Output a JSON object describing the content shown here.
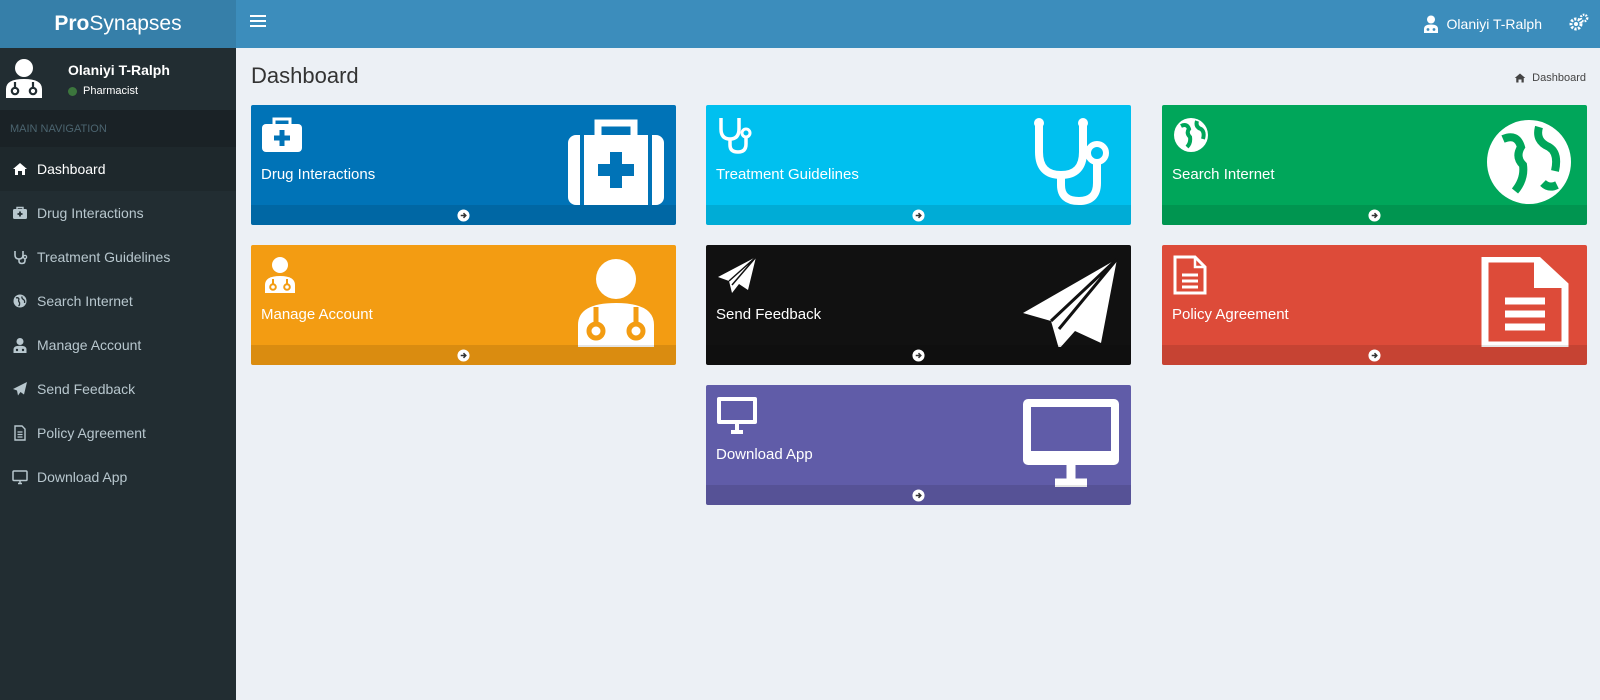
{
  "app": {
    "logo_bold": "Pro",
    "logo_rest": "Synapses"
  },
  "header": {
    "user_name": "Olaniyi T-Ralph"
  },
  "sidebar": {
    "user_name": "Olaniyi T-Ralph",
    "user_role": "Pharmacist",
    "status_color": "#3c763d",
    "section_header": "MAIN NAVIGATION",
    "items": [
      {
        "label": "Dashboard",
        "icon": "home-icon",
        "active": true
      },
      {
        "label": "Drug Interactions",
        "icon": "medkit-icon"
      },
      {
        "label": "Treatment Guidelines",
        "icon": "stethoscope-icon"
      },
      {
        "label": "Search Internet",
        "icon": "globe-icon"
      },
      {
        "label": "Manage Account",
        "icon": "user-md-icon"
      },
      {
        "label": "Send Feedback",
        "icon": "paper-plane-icon"
      },
      {
        "label": "Policy Agreement",
        "icon": "file-text-icon"
      },
      {
        "label": "Download App",
        "icon": "desktop-icon"
      }
    ]
  },
  "content": {
    "page_title": "Dashboard",
    "breadcrumb": "Dashboard"
  },
  "tiles": [
    {
      "label": "Drug Interactions",
      "icon": "medkit-icon",
      "color": "#0073b7"
    },
    {
      "label": "Treatment Guidelines",
      "icon": "stethoscope-icon",
      "color": "#00c0ef"
    },
    {
      "label": "Search Internet",
      "icon": "globe-icon",
      "color": "#00a65a"
    },
    {
      "label": "Manage Account",
      "icon": "user-md-icon",
      "color": "#f39c12"
    },
    {
      "label": "Send Feedback",
      "icon": "paper-plane-icon",
      "color": "#111111"
    },
    {
      "label": "Policy Agreement",
      "icon": "file-text-icon",
      "color": "#dd4b39"
    },
    {
      "label": "Download App",
      "icon": "desktop-icon",
      "color": "#605ca8"
    }
  ]
}
